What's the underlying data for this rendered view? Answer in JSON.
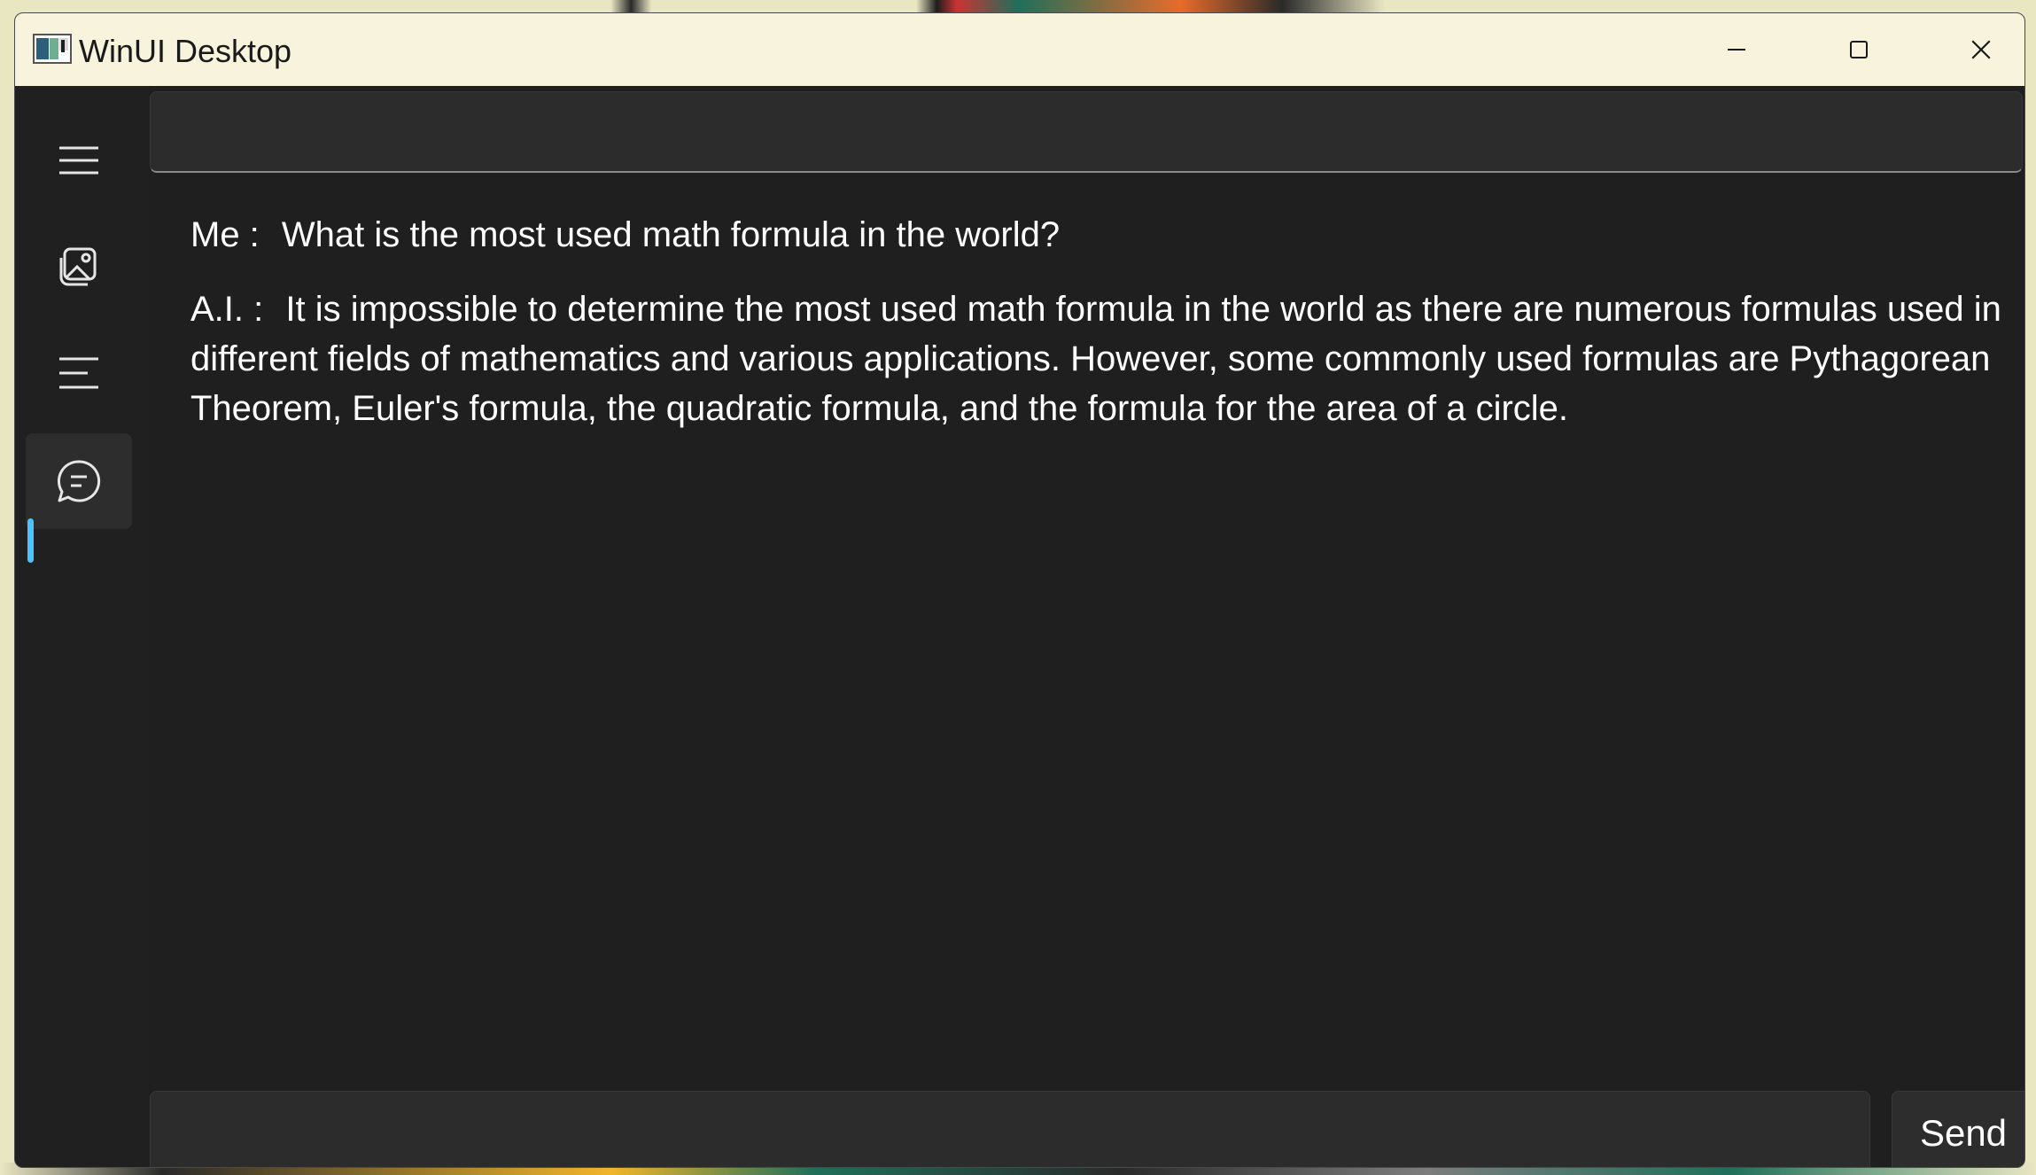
{
  "window": {
    "title": "WinUI Desktop"
  },
  "sidebar": {
    "items": [
      {
        "icon": "hamburger-menu-icon"
      },
      {
        "icon": "image-icon"
      },
      {
        "icon": "text-lines-icon"
      },
      {
        "icon": "chat-icon",
        "selected": true
      }
    ],
    "accent_color": "#4cc2ff"
  },
  "chat": {
    "messages": [
      {
        "speaker": "Me :",
        "text": "What is the most used math formula in the world?"
      },
      {
        "speaker": "A.I. :",
        "text": "It is impossible to determine the most used math formula in the world as there are numerous formulas used in different fields of mathematics and various applications. However, some commonly used formulas are Pythagorean Theorem, Euler's formula, the quadratic formula, and the formula for the area of a circle."
      }
    ],
    "input_value": "",
    "send_label": "Send"
  }
}
